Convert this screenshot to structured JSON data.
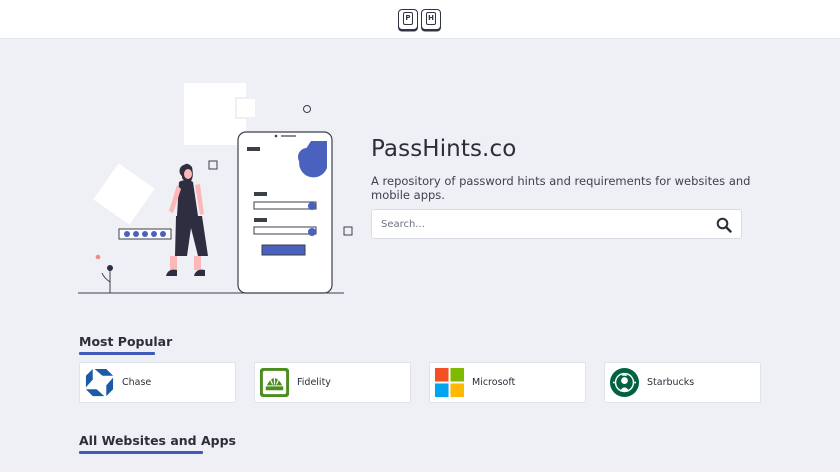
{
  "header": {
    "logo_keys": [
      "P",
      "H"
    ]
  },
  "hero": {
    "title": "PassHints.co",
    "tagline": "A repository of password hints and requirements for websites and mobile apps.",
    "search": {
      "placeholder": "Search...",
      "value": ""
    }
  },
  "popular": {
    "title": "Most Popular",
    "items": [
      {
        "name": "Chase",
        "icon": "chase-logo",
        "color": "#1a5aa6"
      },
      {
        "name": "Fidelity",
        "icon": "fidelity-logo",
        "color": "#4d8c1f"
      },
      {
        "name": "Microsoft",
        "icon": "microsoft-logo",
        "color": "#f25022"
      },
      {
        "name": "Starbucks",
        "icon": "starbucks-logo",
        "color": "#006241"
      }
    ]
  },
  "all": {
    "title": "All Websites and Apps"
  },
  "colors": {
    "accent": "#3f5bb7",
    "background": "#eff0f5"
  }
}
